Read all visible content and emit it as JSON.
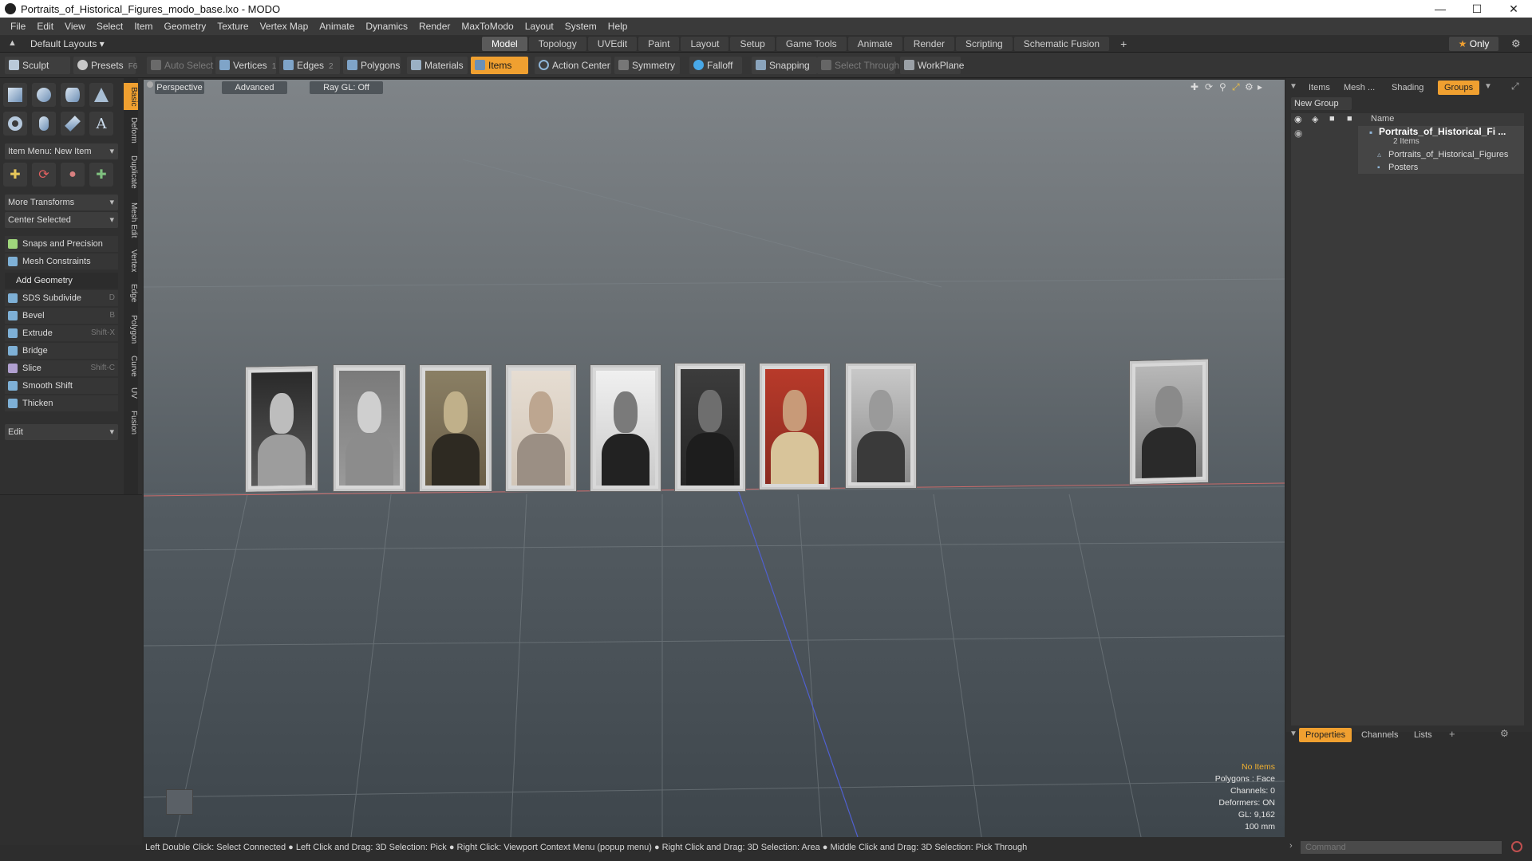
{
  "window": {
    "title": "Portraits_of_Historical_Figures_modo_base.lxo - MODO"
  },
  "menu": [
    "File",
    "Edit",
    "View",
    "Select",
    "Item",
    "Geometry",
    "Texture",
    "Vertex Map",
    "Animate",
    "Dynamics",
    "Render",
    "MaxToModo",
    "Layout",
    "System",
    "Help"
  ],
  "layout": {
    "selector": "Default Layouts",
    "tabs": [
      "Model",
      "Topology",
      "UVEdit",
      "Paint",
      "Layout",
      "Setup",
      "Game Tools",
      "Animate",
      "Render",
      "Scripting",
      "Schematic Fusion"
    ],
    "active_tab": "Model",
    "only_label": "Only"
  },
  "toolbar": {
    "sculpt": "Sculpt",
    "presets": "Presets",
    "presets_key": "F6",
    "auto_select": "Auto Select",
    "vertices": "Vertices",
    "vertices_count": "1",
    "edges": "Edges",
    "edges_count": "2",
    "polygons": "Polygons",
    "materials": "Materials",
    "items": "Items",
    "action_center": "Action Center",
    "symmetry": "Symmetry",
    "falloff": "Falloff",
    "snapping": "Snapping",
    "select_through": "Select Through",
    "workplane": "WorkPlane"
  },
  "leftpanel": {
    "item_menu": "Item Menu: New Item",
    "more_transforms": "More Transforms",
    "center_selected": "Center Selected",
    "snaps": "Snaps and Precision",
    "mesh_constraints": "Mesh Constraints",
    "add_geometry": "Add Geometry",
    "tools": [
      {
        "label": "SDS Subdivide",
        "key": "D"
      },
      {
        "label": "Bevel",
        "key": "B"
      },
      {
        "label": "Extrude",
        "key": "Shift-X"
      },
      {
        "label": "Bridge",
        "key": ""
      },
      {
        "label": "Slice",
        "key": "Shift-C"
      },
      {
        "label": "Smooth Shift",
        "key": ""
      },
      {
        "label": "Thicken",
        "key": ""
      }
    ],
    "edit": "Edit",
    "vtabs": [
      "Basic",
      "Deform",
      "Duplicate",
      "Mesh Edit",
      "Vertex",
      "Edge",
      "Polygon",
      "Curve",
      "UV",
      "Fusion"
    ]
  },
  "viewport": {
    "perspective": "Perspective",
    "advanced": "Advanced",
    "raygl": "Ray GL: Off",
    "stats": {
      "items": "No Items",
      "polygons": "Polygons : Face",
      "channels": "Channels: 0",
      "deformers": "Deformers: ON",
      "gl": "GL: 9,162",
      "scale": "100 mm"
    }
  },
  "rightpanel": {
    "tabs": [
      "Items",
      "Mesh ...",
      "Shading",
      "Groups"
    ],
    "active_tab": "Groups",
    "new_group": "New Group",
    "name_col": "Name",
    "tree": {
      "root": "Portraits_of_Historical_Fi ...",
      "root_sub": "2 Items",
      "child1": "Portraits_of_Historical_Figures",
      "child2": "Posters"
    },
    "bottom_tabs": [
      "Properties",
      "Channels",
      "Lists"
    ],
    "active_bottom_tab": "Properties"
  },
  "statusbar": "Left Double Click: Select Connected ● Left Click and Drag: 3D Selection: Pick ● Right Click: Viewport Context Menu (popup menu) ● Right Click and Drag: 3D Selection: Area ● Middle Click and Drag: 3D Selection: Pick Through",
  "command": {
    "placeholder": "Command"
  },
  "colors": {
    "accent": "#f0a030",
    "background": "#2d2d2d"
  }
}
